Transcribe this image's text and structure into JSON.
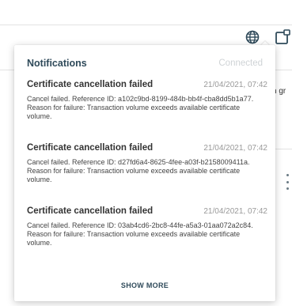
{
  "background": {
    "peek_text": "h gr"
  },
  "toolbar": {
    "globe_icon": "globe-icon",
    "expand_icon": "expand-window-icon"
  },
  "notifications": {
    "title": "Notifications",
    "status": "Connected",
    "items": [
      {
        "title": "Certificate cancellation failed",
        "time": "21/04/2021, 07:42",
        "message": "Cancel failed. Reference ID: a102c9bd-8199-484b-bb4f-cba8dd5b1a77. Reason for failure: Transaction volume exceeds available certificate volume."
      },
      {
        "title": "Certificate cancellation failed",
        "time": "21/04/2021, 07:42",
        "message": "Cancel failed. Reference ID: d27fd6a4-8625-4fee-a03f-b2158009411a. Reason for failure: Transaction volume exceeds available certificate volume."
      },
      {
        "title": "Certificate cancellation failed",
        "time": "21/04/2021, 07:42",
        "message": "Cancel failed. Reference ID: 03ab4cd6-2bc8-44fe-a5a3-01aa072a2c84. Reason for failure: Transaction volume exceeds available certificate volume."
      }
    ],
    "show_more_label": "SHOW MORE"
  },
  "colors": {
    "accent": "#2f4a5a",
    "muted": "#cfd3d6",
    "timestamp": "#999999"
  }
}
